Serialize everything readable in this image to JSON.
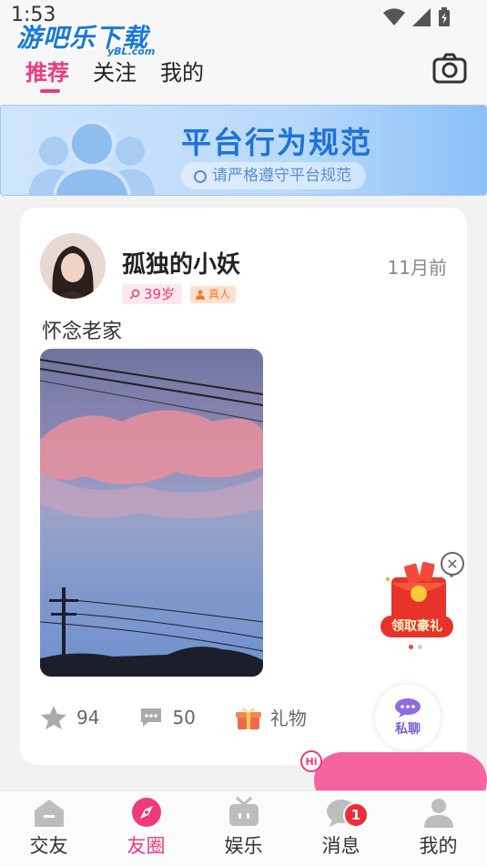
{
  "status_bar": {
    "time": "1:53"
  },
  "watermark": {
    "text": "游吧乐下载",
    "sub": "yBL.com"
  },
  "header": {
    "tabs": [
      {
        "label": "推荐",
        "active": true
      },
      {
        "label": "关注",
        "active": false
      },
      {
        "label": "我的",
        "active": false
      }
    ],
    "camera_icon": "camera-icon"
  },
  "banner": {
    "title": "平台行为规范",
    "subtitle": "请严格遵守平台规范"
  },
  "post": {
    "username": "孤独的小妖",
    "time_ago": "11月前",
    "age": "39岁",
    "verified_label": "真人",
    "text": "怀念老家",
    "likes": "94",
    "comments": "50",
    "gift_label": "礼物",
    "private_chat_label": "私聊"
  },
  "gift_float": {
    "label": "领取豪礼"
  },
  "hi_badge": "Hi",
  "bottom_nav": {
    "items": [
      {
        "label": "交友",
        "icon": "house-icon",
        "active": false
      },
      {
        "label": "友圈",
        "icon": "compass-icon",
        "active": true
      },
      {
        "label": "娱乐",
        "icon": "tv-icon",
        "active": false
      },
      {
        "label": "消息",
        "icon": "chat-icon",
        "active": false,
        "badge": "1"
      },
      {
        "label": "我的",
        "icon": "person-icon",
        "active": false
      }
    ]
  },
  "colors": {
    "accent": "#ee3a7b",
    "banner_title": "#1e73d8",
    "pink_float": "#f564a0"
  }
}
